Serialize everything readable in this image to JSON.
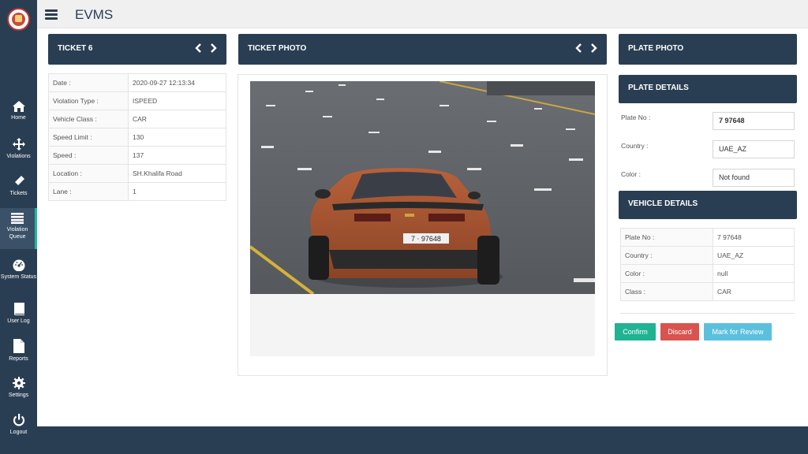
{
  "app": {
    "title": "EVMS"
  },
  "sidebar": {
    "items": [
      {
        "label": "Home",
        "icon": "home-icon"
      },
      {
        "label": "Violations",
        "icon": "arrows-icon"
      },
      {
        "label": "Tickets",
        "icon": "ticket-icon"
      },
      {
        "label": "Violation Queue",
        "icon": "list-icon",
        "active": true
      },
      {
        "label": "System Status",
        "icon": "gauge-icon"
      },
      {
        "label": "User Log",
        "icon": "book-icon"
      },
      {
        "label": "Reports",
        "icon": "file-icon"
      },
      {
        "label": "Settings",
        "icon": "gear-icon"
      },
      {
        "label": "Logout",
        "icon": "power-icon"
      }
    ]
  },
  "ticket": {
    "header": "TICKET 6",
    "rows": [
      {
        "key": "Date :",
        "value": "2020-09-27 12:13:34"
      },
      {
        "key": "Violation Type :",
        "value": "ISPEED"
      },
      {
        "key": "Vehicle Class :",
        "value": "CAR"
      },
      {
        "key": "Speed Limit :",
        "value": "130"
      },
      {
        "key": "Speed :",
        "value": "137"
      },
      {
        "key": "Location :",
        "value": "SH.Khalifa Road"
      },
      {
        "key": "Lane :",
        "value": "1"
      }
    ]
  },
  "ticket_photo": {
    "header": "TICKET PHOTO",
    "plate_text": "7 ⋅ 97648"
  },
  "plate_photo": {
    "header": "PLATE PHOTO"
  },
  "plate_details": {
    "header": "PLATE DETAILS",
    "plate_label": "Plate No :",
    "plate_value": "7 97648",
    "country_label": "Country :",
    "country_value": "UAE_AZ",
    "color_label": "Color :",
    "color_value": "Not found"
  },
  "vehicle_details": {
    "header": "VEHICLE DETAILS",
    "rows": [
      {
        "key": "Plate No :",
        "value": "7 97648"
      },
      {
        "key": "Country :",
        "value": "UAE_AZ"
      },
      {
        "key": "Color :",
        "value": "null"
      },
      {
        "key": "Class :",
        "value": "CAR"
      }
    ]
  },
  "actions": {
    "confirm": "Confirm",
    "discard": "Discard",
    "review": "Mark for Review"
  },
  "colors": {
    "navy": "#2a3e53",
    "confirm": "#1fb391",
    "discard": "#d9534f",
    "review": "#5bc0de",
    "active_accent": "#1abc9c"
  }
}
